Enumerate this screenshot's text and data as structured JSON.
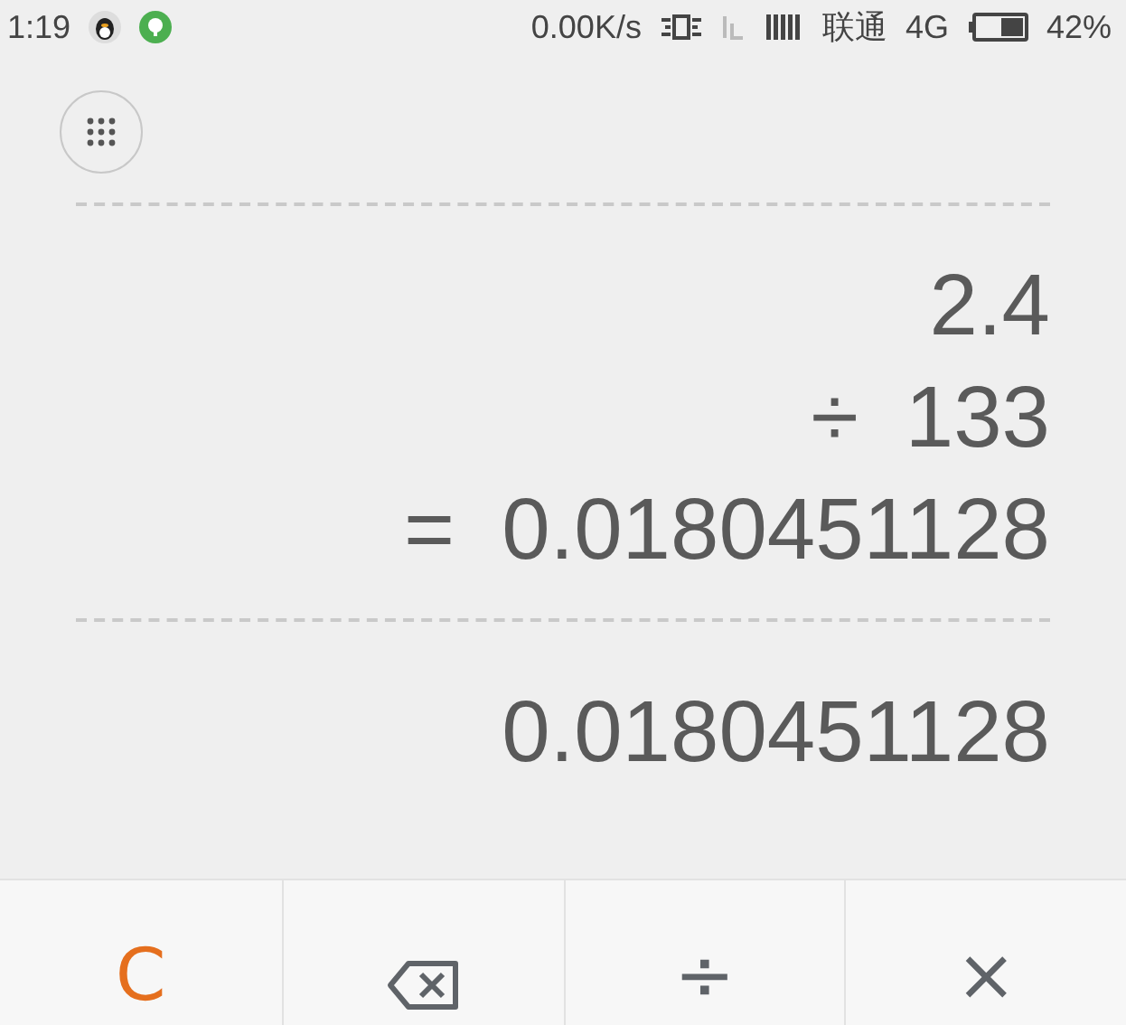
{
  "status_bar": {
    "time": "1:19",
    "speed": "0.00K/s",
    "carrier": "联通",
    "network": "4G",
    "battery": "42%"
  },
  "expression": [
    {
      "value": "2.4"
    },
    {
      "operator": "÷",
      "value": "133"
    },
    {
      "operator": "=",
      "value": "0.0180451128"
    }
  ],
  "result": "0.0180451128",
  "keys": [
    {
      "kind": "text",
      "label": "C",
      "color": "#e56f1e"
    },
    {
      "kind": "backspace",
      "color": "#5f6368"
    },
    {
      "kind": "text",
      "label": "÷",
      "color": "#5f6368"
    },
    {
      "kind": "text",
      "label": "×",
      "color": "#5f6368"
    }
  ]
}
